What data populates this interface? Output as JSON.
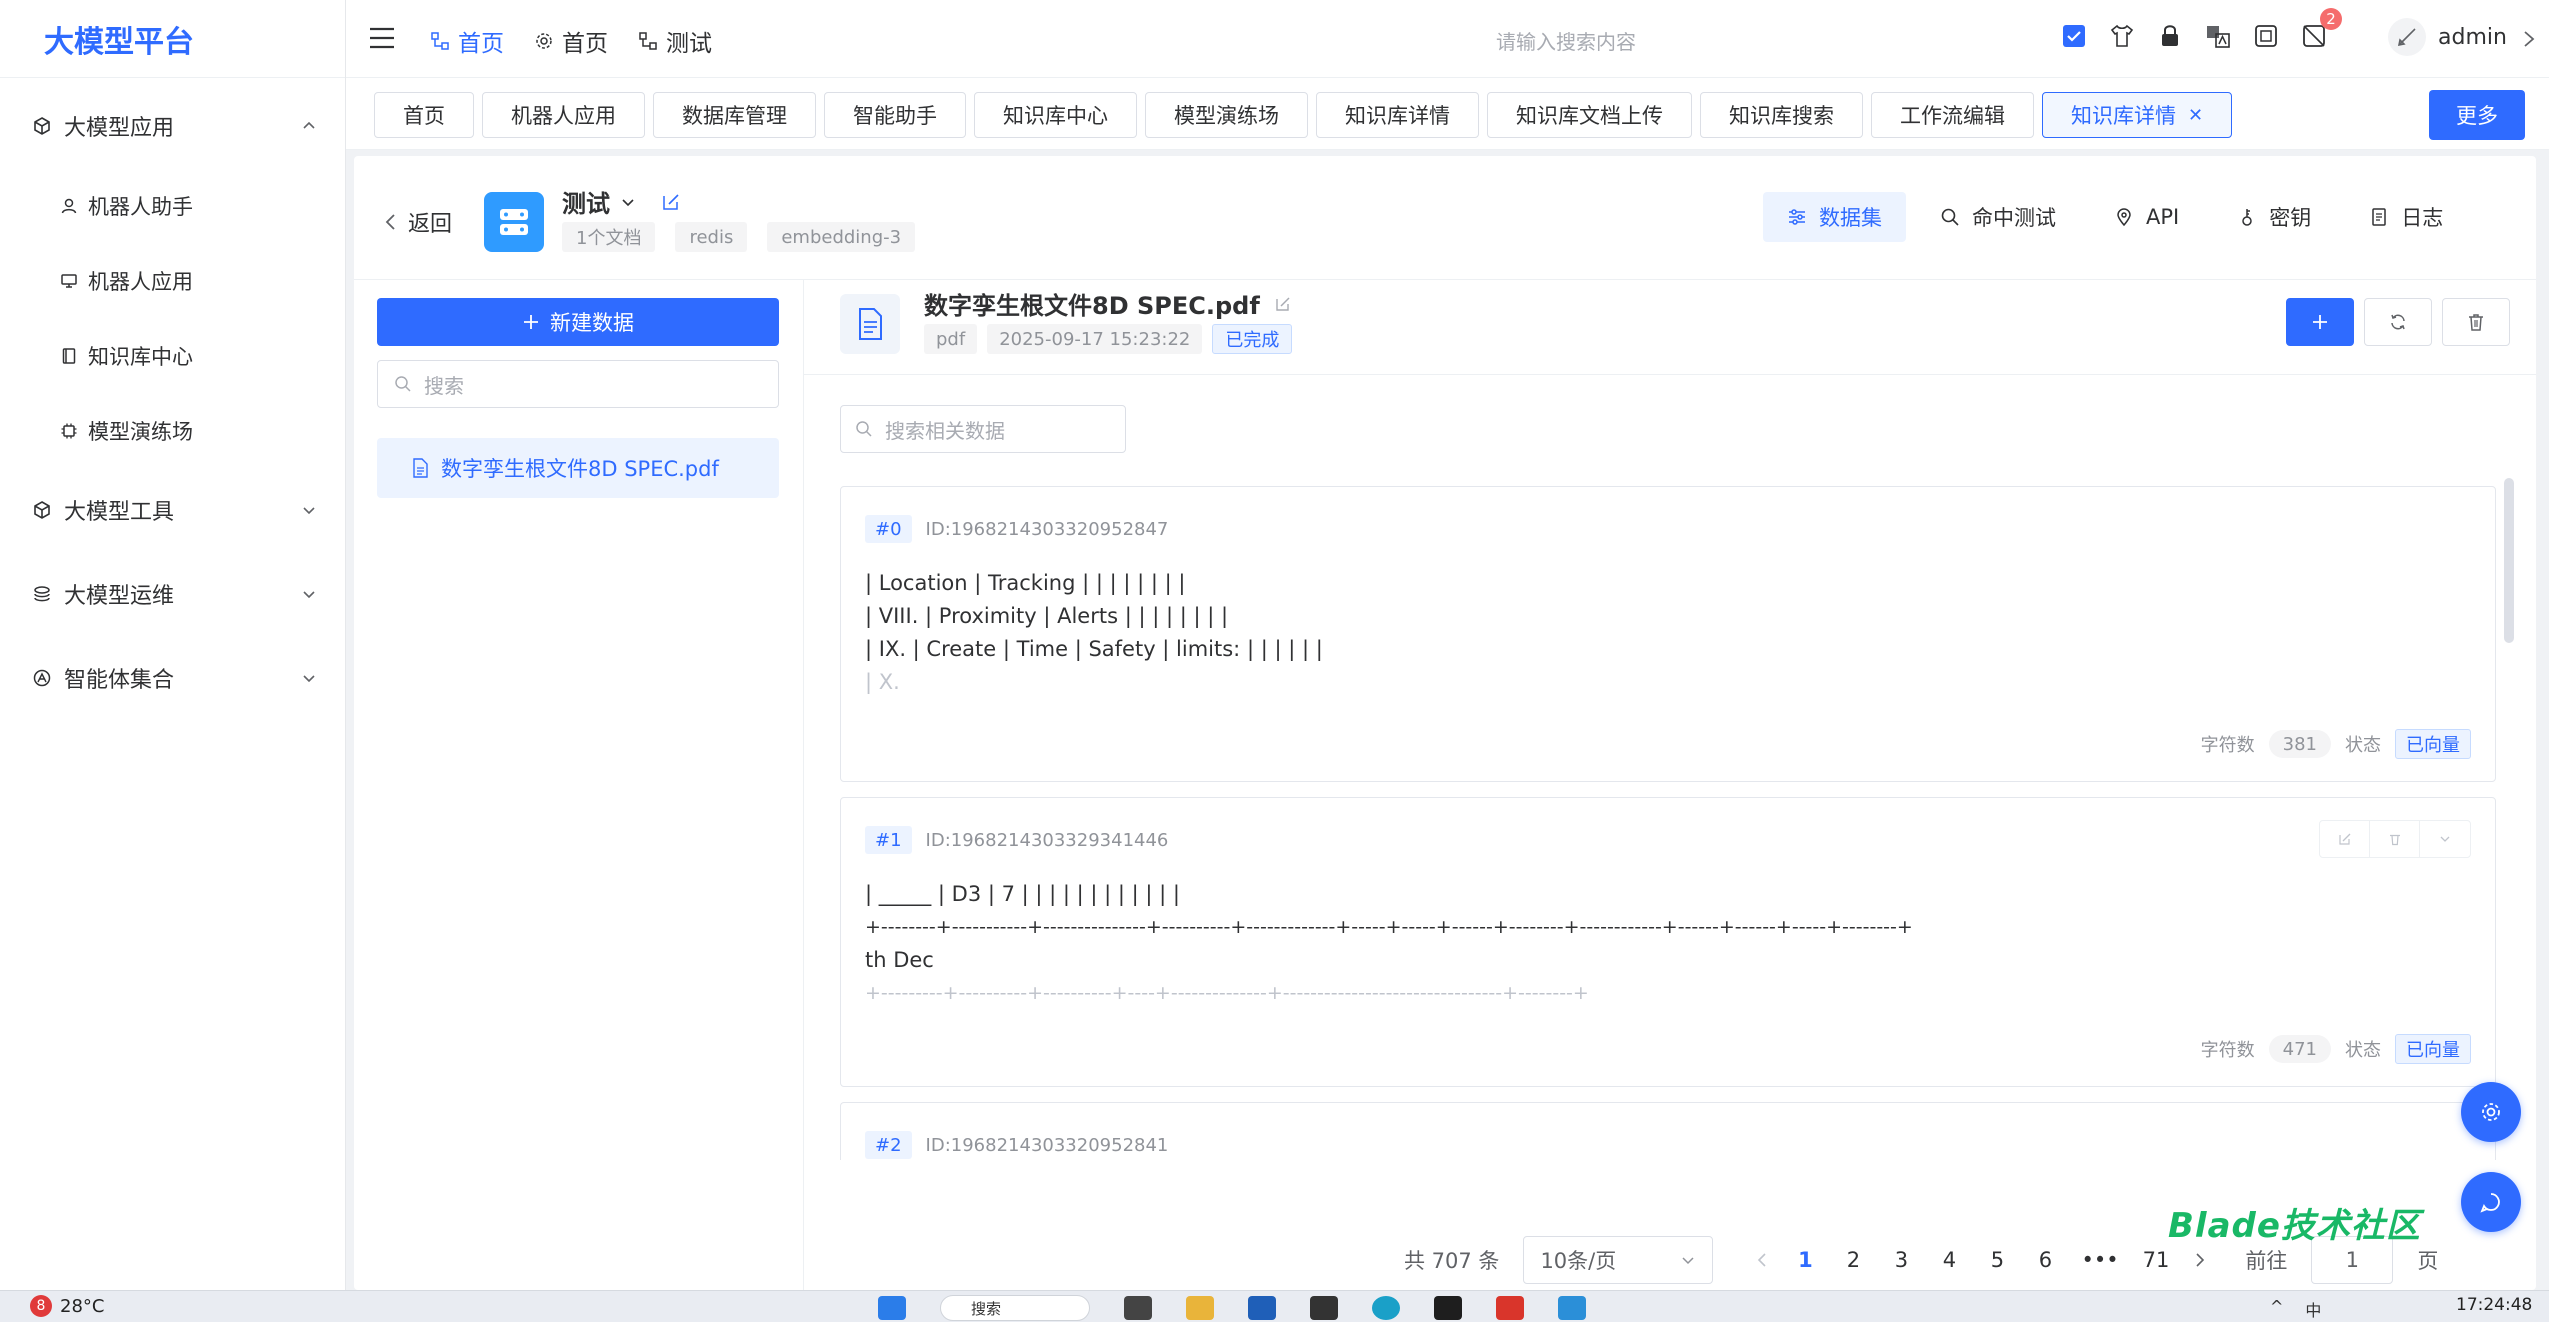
{
  "app": {
    "logo": "大模型平台"
  },
  "sidebar": {
    "groups": [
      {
        "label": "大模型应用",
        "icon": "cube-icon",
        "expanded": true,
        "items": [
          {
            "label": "机器人助手",
            "icon": "user-icon"
          },
          {
            "label": "机器人应用",
            "icon": "monitor-icon"
          },
          {
            "label": "知识库中心",
            "icon": "book-icon"
          },
          {
            "label": "模型演练场",
            "icon": "chip-icon"
          }
        ]
      },
      {
        "label": "大模型工具",
        "icon": "toolbox-icon",
        "expanded": false
      },
      {
        "label": "大模型运维",
        "icon": "layers-icon",
        "expanded": false
      },
      {
        "label": "智能体集合",
        "icon": "agent-icon",
        "expanded": false
      }
    ]
  },
  "header": {
    "nav": [
      {
        "label": "首页",
        "icon": "flow-icon",
        "active": true
      },
      {
        "label": "首页",
        "icon": "gear-icon",
        "active": false
      },
      {
        "label": "测试",
        "icon": "flow-icon",
        "active": false
      }
    ],
    "search_placeholder": "请输入搜索内容",
    "icons": [
      "checkbox-icon",
      "shirt-icon",
      "lock-icon",
      "translate-icon",
      "fullscreen-icon",
      "notification-icon"
    ],
    "notification_count": "2",
    "user": "admin"
  },
  "tags": {
    "items": [
      "首页",
      "机器人应用",
      "数据库管理",
      "智能助手",
      "知识库中心",
      "模型演练场",
      "知识库详情",
      "知识库文档上传",
      "知识库搜索",
      "工作流编辑",
      "知识库详情"
    ],
    "active_index": 10,
    "more_label": "更多"
  },
  "kb": {
    "back_label": "返回",
    "name": "测试",
    "tags": [
      "1个文档",
      "redis",
      "embedding-3"
    ],
    "tabs": [
      {
        "label": "数据集",
        "icon": "sliders-icon",
        "active": true
      },
      {
        "label": "命中测试",
        "icon": "search-icon",
        "active": false
      },
      {
        "label": "API",
        "icon": "location-icon",
        "active": false
      },
      {
        "label": "密钥",
        "icon": "key-icon",
        "active": false
      },
      {
        "label": "日志",
        "icon": "doc-icon",
        "active": false
      }
    ]
  },
  "list": {
    "new_label": "新建数据",
    "search_placeholder": "搜索",
    "files": [
      "数字孪生根文件8D SPEC.pdf"
    ]
  },
  "doc": {
    "name": "数字孪生根文件8D SPEC.pdf",
    "tags": [
      "pdf",
      "2025-09-17 15:23:22"
    ],
    "status": "已完成",
    "chunk_search_placeholder": "搜索相关数据"
  },
  "chunks": [
    {
      "no": "#0",
      "id": "ID:1968214303320952847",
      "lines": [
        "| Location | Tracking | | | | | | | |",
        "| VIII. | Proximity | Alerts | | | | | | | |",
        "| IX. | Create | Time | Safety | limits: | | | | | |"
      ],
      "faded": "| X.",
      "chars_label": "字符数",
      "chars": "381",
      "status_label": "状态",
      "status": "已向量"
    },
    {
      "no": "#1",
      "id": "ID:1968214303329341446",
      "lines": [
        "| _____ | D3 | 7 | | | | | | | | | | | |",
        "+--------+-----------+---------------+----------+-------------+-----+-----+------+--------+------------+------+------+-----+--------+",
        "th Dec"
      ],
      "faded": "+---------+----------+----------+----+--------------+--------------------------------+--------+",
      "chars_label": "字符数",
      "chars": "471",
      "status_label": "状态",
      "status": "已向量"
    },
    {
      "no": "#2",
      "id": "ID:1968214303320952841"
    }
  ],
  "pager": {
    "total": "共 707 条",
    "page_size": "10条/页",
    "pages": [
      "1",
      "2",
      "3",
      "4",
      "5",
      "6",
      "•••",
      "71"
    ],
    "current": "1",
    "jump_label": "前往",
    "jump_value": "1",
    "jump_suffix": "页"
  },
  "watermark": "Blade技术社区",
  "taskbar": {
    "weather_badge": "8",
    "weather": "28°C",
    "search": "搜索",
    "tray_lang": "中",
    "time": "17:24:48"
  }
}
